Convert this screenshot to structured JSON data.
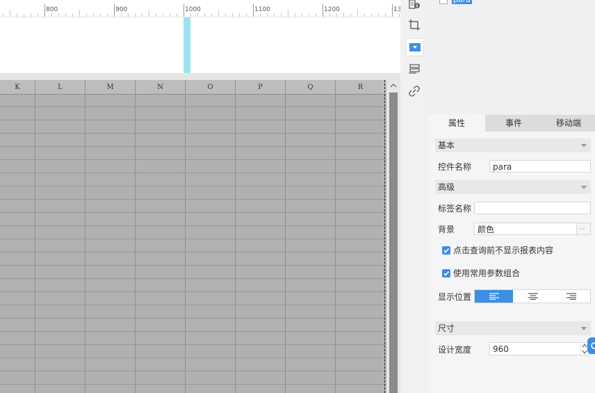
{
  "ruler": {
    "labels": [
      "800",
      "900",
      "1000",
      "1100",
      "1200",
      "13"
    ]
  },
  "sheet": {
    "columns": [
      "K",
      "L",
      "M",
      "N",
      "O",
      "P",
      "Q",
      "R"
    ]
  },
  "tools": [
    {
      "icon": "event-info-icon"
    },
    {
      "icon": "crop-frame-icon"
    },
    {
      "icon": "dropdown-widget-icon",
      "active": true
    },
    {
      "icon": "layer-list-icon"
    },
    {
      "icon": "link-icon"
    }
  ],
  "widget_tree": {
    "item_label": "para"
  },
  "tabs": [
    "属性",
    "事件",
    "移动端"
  ],
  "sections": {
    "basic": "基本",
    "advanced": "高级",
    "size": "尺寸"
  },
  "fields": {
    "widget_name_label": "控件名称",
    "widget_name_value": "para",
    "tag_name_label": "标签名称",
    "tag_name_value": "",
    "background_label": "背景",
    "background_value": "颜色",
    "background_more": "···",
    "checkbox1_label": "点击查询前不显示报表内容",
    "checkbox2_label": "使用常用参数组合",
    "position_label": "显示位置",
    "design_width_label": "设计宽度",
    "design_width_value": "960"
  },
  "colors": {
    "accent": "#3e8ee6",
    "marker": "#9ce3f2",
    "sheet_bg": "#b1b1b1"
  }
}
